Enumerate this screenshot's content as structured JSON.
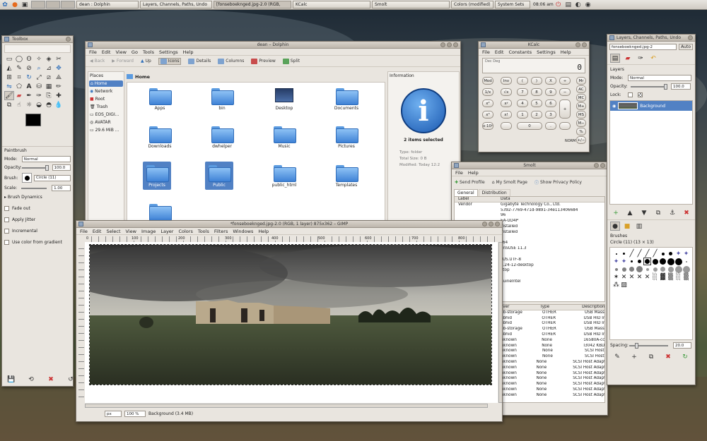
{
  "panel": {
    "tasks": [
      "dean : Dolphin",
      "Layers, Channels, Paths, Undo",
      "[fonseboeknged.jpg-2.0 (RGB,",
      "KCalc",
      "Smolt",
      "Colors (modified)",
      "System Sets"
    ],
    "clock": "08:06 am"
  },
  "dolphin": {
    "title": "dean – Dolphin",
    "menu": [
      "File",
      "Edit",
      "View",
      "Go",
      "Tools",
      "Settings",
      "Help"
    ],
    "toolbar": [
      "Back",
      "Forward",
      "Up",
      "Icons",
      "Details",
      "Columns",
      "Preview",
      "Split"
    ],
    "places_title": "Places",
    "places": [
      "Home",
      "Network",
      "Root",
      "Trash",
      "EOS_DIGI...",
      "AVATAR",
      "29.6 MiB ..."
    ],
    "location": "Home",
    "files": [
      "Apps",
      "bin",
      "Desktop",
      "Documents",
      "Downloads",
      "dwhelper",
      "Music",
      "Pictures",
      "Projects",
      "Public",
      "public_html",
      "Templates"
    ],
    "info_title": "Information",
    "info_summary": "2 items selected",
    "info_rows": [
      {
        "k": "Type:",
        "v": "folder"
      },
      {
        "k": "Total Size:",
        "v": "0 B"
      },
      {
        "k": "Modified:",
        "v": "Today 12:2"
      }
    ]
  },
  "kcalc": {
    "title": "KCalc",
    "menu": [
      "File",
      "Edit",
      "Constants",
      "Settings",
      "Help"
    ],
    "mode": "Dec  Deg",
    "display": "0",
    "keys_left": [
      "Mod",
      "1/x",
      "x²",
      "x³",
      "x·10ʸ"
    ],
    "keys_left2": [
      "Inv",
      "√x",
      "xʸ",
      "x!",
      ""
    ],
    "digits": [
      [
        "(",
        ")",
        "X",
        "÷"
      ],
      [
        "7",
        "8",
        "9",
        "−"
      ],
      [
        "4",
        "5",
        "6",
        "+"
      ],
      [
        "1",
        "2",
        "3",
        ""
      ],
      [
        "0",
        ".",
        "",
        ""
      ]
    ],
    "keys_right": [
      "Mr",
      "AC",
      "MC",
      "M+",
      "MS",
      "M−",
      "%",
      "+/−"
    ],
    "keys_right2": [
      "C",
      "C",
      "",
      "",
      "",
      "",
      "",
      ""
    ],
    "status": "NORM"
  },
  "layers": {
    "title": "Layers, Channels, Paths, Undo",
    "image_select": "fonseboeknged.jpg-2",
    "auto": "Auto",
    "layers_label": "Layers",
    "mode_label": "Mode:",
    "mode_value": "Normal",
    "opacity_label": "Opacity:",
    "opacity_value": "100.0",
    "lock_label": "Lock:",
    "layer_name": "Background",
    "brushes_label": "Brushes",
    "brush_name": "Circle (11) (13 × 13)",
    "spacing_label": "Spacing:",
    "spacing_value": "20.0"
  },
  "toolbox": {
    "title": "Toolbox",
    "tool_title": "Paintbrush",
    "mode_label": "Mode:",
    "mode_value": "Normal",
    "opacity_label": "Opacity:",
    "opacity_value": "100.0",
    "brush_label": "Brush:",
    "brush_value": "Circle (11)",
    "scale_label": "Scale:",
    "scale_value": "1.00",
    "options": [
      "Brush Dynamics",
      "Fade out",
      "Apply Jitter",
      "Incremental",
      "Use color from gradient"
    ]
  },
  "smolt": {
    "title": "Smolt",
    "menu": [
      "File",
      "Help"
    ],
    "actions": [
      "Send Profile",
      "My Smolt Page",
      "Show Privacy Policy"
    ],
    "tabs": [
      "General",
      "Distribution"
    ],
    "cols": [
      "Label",
      "Data"
    ],
    "general_rows": [
      {
        "label": "Vendor",
        "data": "Gigabyte Technology Co., Ltd."
      },
      {
        "label": "",
        "data": "5392-7769-471d-9891-34e113406684"
      },
      {
        "label": "",
        "data": "96"
      },
      {
        "label": "",
        "data": "5A-UD4P"
      },
      {
        "label": "",
        "data": "installed"
      },
      {
        "label": "",
        "data": "installed"
      },
      {
        "label": "",
        "data": ""
      },
      {
        "label": "",
        "data": "_64"
      },
      {
        "label": "",
        "data": "enSUSE 11.3"
      },
      {
        "label": "",
        "data": ""
      },
      {
        "label": "",
        "data": "_US.UTF-8"
      },
      {
        "label": "",
        "data": "3.24-12-desktop"
      },
      {
        "label": "",
        "data": "ktop"
      },
      {
        "label": "",
        "data": ""
      },
      {
        "label": "",
        "data": "nuineIntel"
      }
    ],
    "dev_cols": [
      "Driver",
      "Type",
      "Description"
    ],
    "devices": [
      {
        "d": "usb-storage",
        "t": "OTHER",
        "x": "USB Mass"
      },
      {
        "d": "usbhid",
        "t": "OTHER",
        "x": "USB HID Ir"
      },
      {
        "d": "usbhid",
        "t": "OTHER",
        "x": "USB HID Ir"
      },
      {
        "d": "usb-storage",
        "t": "OTHER",
        "x": "USB Mass"
      },
      {
        "d": "usbhid",
        "t": "OTHER",
        "x": "USB HID Ir"
      },
      {
        "d": "unknown",
        "t": "None",
        "x": "16580A-cc"
      },
      {
        "d": "unknown",
        "t": "None",
        "x": "I3042 KBD"
      },
      {
        "d": "unknown",
        "t": "None",
        "x": "SCSI Host"
      },
      {
        "d": "unknown",
        "t": "None",
        "x": "SCSI Host"
      },
      {
        "d": "unknown",
        "t": "None",
        "x": "SCSI Host Adaptor"
      },
      {
        "d": "unknown",
        "t": "None",
        "x": "SCSI Host Adaptor"
      },
      {
        "d": "unknown",
        "t": "None",
        "x": "SCSI Host Adaptor"
      },
      {
        "d": "unknown",
        "t": "None",
        "x": "SCSI Host Adaptor"
      },
      {
        "d": "unknown",
        "t": "None",
        "x": "SCSI Host Adaptor"
      },
      {
        "d": "unknown",
        "t": "None",
        "x": "SCSI Host Adaptor"
      },
      {
        "d": "unknown",
        "t": "None",
        "x": "SCSI Host Adaptor"
      }
    ]
  },
  "gimp": {
    "title": "*fonseboeknged.jpg-2.0 (RGB, 1 layer) 875x362 – GIMP",
    "menu": [
      "File",
      "Edit",
      "Select",
      "View",
      "Image",
      "Layer",
      "Colors",
      "Tools",
      "Filters",
      "Windows",
      "Help"
    ],
    "ruler_ticks": [
      "0",
      "100",
      "200",
      "300",
      "400",
      "500",
      "600",
      "700",
      "800"
    ],
    "unit": "px",
    "zoom": "100 %",
    "status": "Background (3.4 MB)"
  }
}
